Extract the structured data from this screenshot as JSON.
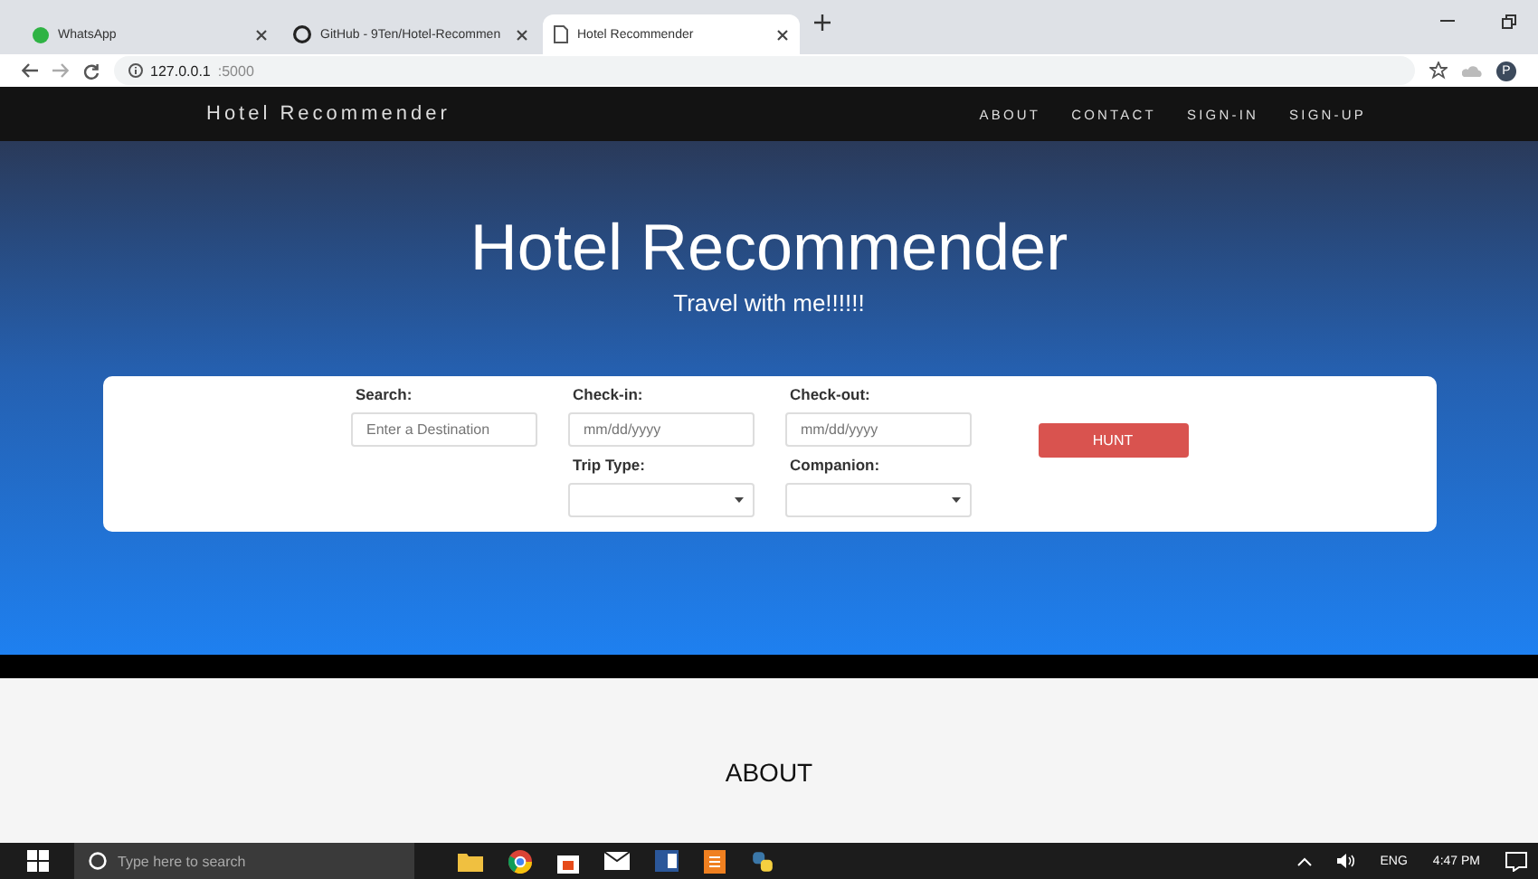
{
  "browser": {
    "tabs": [
      {
        "title": "WhatsApp",
        "selected": false
      },
      {
        "title": "GitHub - 9Ten/Hotel-Recommen",
        "selected": false
      },
      {
        "title": "Hotel Recommender",
        "selected": true
      }
    ],
    "address": {
      "host": "127.0.0.1",
      "port": ":5000"
    },
    "profile": "P"
  },
  "navbar": {
    "brand": "Hotel Recommender",
    "links": [
      "ABOUT",
      "CONTACT",
      "SIGN-IN",
      "SIGN-UP"
    ]
  },
  "hero": {
    "title": "Hotel Recommender",
    "subtitle": "Travel with me!!!!!!"
  },
  "form": {
    "search": {
      "label": "Search:",
      "placeholder": "Enter a Destination"
    },
    "checkin": {
      "label": "Check-in:",
      "placeholder": "mm/dd/yyyy"
    },
    "checkout": {
      "label": "Check-out:",
      "placeholder": "mm/dd/yyyy"
    },
    "trip_type": {
      "label": "Trip Type:"
    },
    "companion": {
      "label": "Companion:"
    },
    "button": "HUNT"
  },
  "about": {
    "heading": "ABOUT"
  },
  "taskbar": {
    "search_placeholder": "Type here to search",
    "language": "ENG",
    "time": "4:47 PM"
  }
}
